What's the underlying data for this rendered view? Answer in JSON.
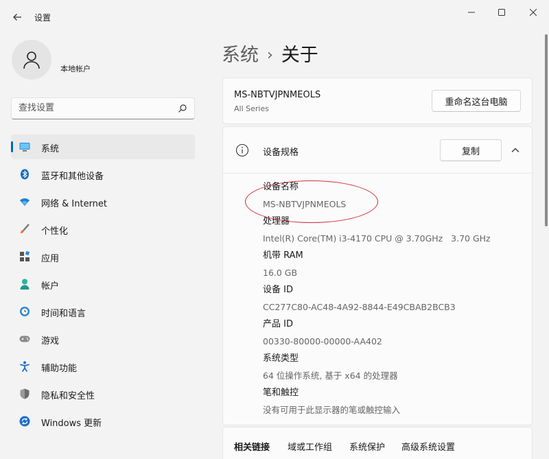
{
  "window": {
    "title": "设置"
  },
  "account": {
    "name": "本地帐户"
  },
  "search": {
    "placeholder": "查找设置"
  },
  "sidebar": {
    "items": [
      {
        "label": "系统",
        "icon": "system-icon",
        "active": true
      },
      {
        "label": "蓝牙和其他设备",
        "icon": "bluetooth-icon"
      },
      {
        "label": "网络 & Internet",
        "icon": "network-icon"
      },
      {
        "label": "个性化",
        "icon": "brush-icon"
      },
      {
        "label": "应用",
        "icon": "apps-icon"
      },
      {
        "label": "帐户",
        "icon": "account-icon"
      },
      {
        "label": "时间和语言",
        "icon": "time-language-icon"
      },
      {
        "label": "游戏",
        "icon": "gamepad-icon"
      },
      {
        "label": "辅助功能",
        "icon": "accessibility-icon"
      },
      {
        "label": "隐私和安全性",
        "icon": "shield-icon"
      },
      {
        "label": "Windows 更新",
        "icon": "update-icon"
      }
    ]
  },
  "breadcrumb": {
    "parent": "系统",
    "separator": "›",
    "current": "关于"
  },
  "pc": {
    "name": "MS-NBTVJPNMEOLS",
    "model": "All Series",
    "rename_label": "重命名这台电脑"
  },
  "specs": {
    "title": "设备规格",
    "copy_label": "复制",
    "rows": [
      {
        "label": "设备名称",
        "value": "MS-NBTVJPNMEOLS"
      },
      {
        "label": "处理器",
        "value": "Intel(R) Core(TM) i3-4170 CPU @ 3.70GHz   3.70 GHz"
      },
      {
        "label": "机带 RAM",
        "value": "16.0 GB"
      },
      {
        "label": "设备 ID",
        "value": "CC277C80-AC48-4A92-8844-E49CBAB2BCB3"
      },
      {
        "label": "产品 ID",
        "value": "00330-80000-00000-AA402"
      },
      {
        "label": "系统类型",
        "value": "64 位操作系统, 基于 x64 的处理器"
      },
      {
        "label": "笔和触控",
        "value": "没有可用于此显示器的笔或触控输入"
      }
    ]
  },
  "related": {
    "label": "相关链接",
    "links": [
      "域或工作组",
      "系统保护",
      "高级系统设置"
    ]
  },
  "colors": {
    "accent": "#0067c0",
    "annotation": "#cc2e3a"
  }
}
